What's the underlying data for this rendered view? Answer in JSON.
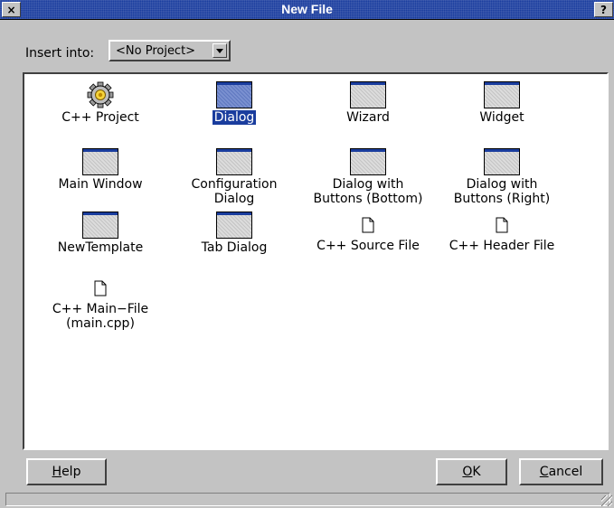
{
  "window": {
    "title": "New File",
    "close_glyph": "×",
    "help_glyph": "?"
  },
  "insert": {
    "label": "Insert into:",
    "selected": "<No Project>"
  },
  "templates": [
    {
      "label": "C++ Project",
      "icon": "gear-icon",
      "selected": false
    },
    {
      "label": "Dialog",
      "icon": "window-icon",
      "selected": true
    },
    {
      "label": "Wizard",
      "icon": "window-icon",
      "selected": false
    },
    {
      "label": "Widget",
      "icon": "window-icon",
      "selected": false
    },
    {
      "label": "Main Window",
      "icon": "window-icon",
      "selected": false
    },
    {
      "label": "Configuration\nDialog",
      "icon": "window-icon",
      "selected": false
    },
    {
      "label": "Dialog with\nButtons (Bottom)",
      "icon": "window-icon",
      "selected": false
    },
    {
      "label": "Dialog with\nButtons (Right)",
      "icon": "window-icon",
      "selected": false
    },
    {
      "label": "NewTemplate",
      "icon": "window-icon",
      "selected": false
    },
    {
      "label": "Tab Dialog",
      "icon": "window-icon",
      "selected": false
    },
    {
      "label": "C++ Source File",
      "icon": "file-icon",
      "selected": false
    },
    {
      "label": "C++ Header File",
      "icon": "file-icon",
      "selected": false
    },
    {
      "label": "C++ Main−File\n(main.cpp)",
      "icon": "file-icon",
      "selected": false
    }
  ],
  "buttons": {
    "help": {
      "mnemonic": "H",
      "rest": "elp"
    },
    "ok": {
      "mnemonic": "O",
      "rest": "K"
    },
    "cancel": {
      "mnemonic": "C",
      "rest": "ancel"
    }
  },
  "colors": {
    "accent": "#1a3d9e",
    "face": "#c3c3c3"
  }
}
